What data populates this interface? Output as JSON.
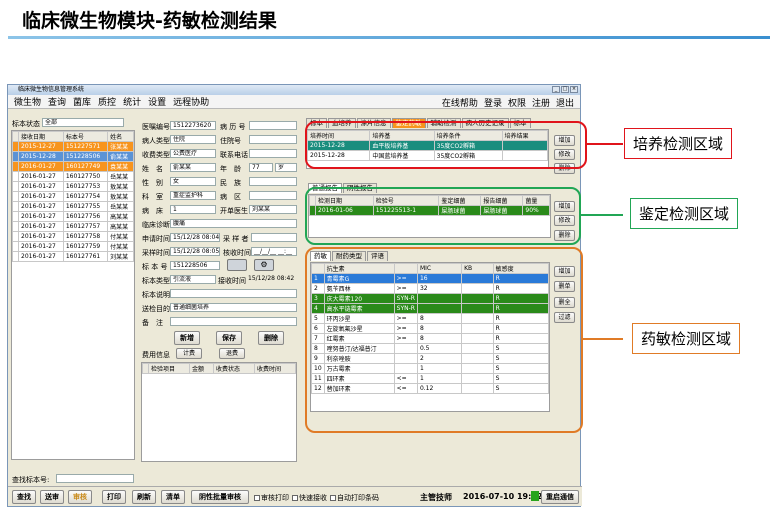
{
  "slide": {
    "title": "临床微生物模块-药敏检测结果"
  },
  "app": {
    "window_title": "临床微生物信息管理系统",
    "menu": [
      "微生物",
      "查询",
      "菌库",
      "质控",
      "统计",
      "设置",
      "远程协助"
    ],
    "menu_right": [
      "在线帮助",
      "登录",
      "权限",
      "注册",
      "退出"
    ]
  },
  "left": {
    "status_label": "标本状态",
    "status_value": "全部",
    "columns": [
      "接收日期",
      "标本号",
      "姓名"
    ],
    "rows": [
      {
        "date": "2015-12-27",
        "id": "151227571",
        "name": "张某某",
        "style": "orange"
      },
      {
        "date": "2015-12-28",
        "id": "151228506",
        "name": "俞某某",
        "style": "blue"
      },
      {
        "date": "2016-01-27",
        "id": "160127749",
        "name": "袁某某",
        "style": "orange"
      },
      {
        "date": "2016-01-27",
        "id": "160127750",
        "name": "岳某某",
        "style": ""
      },
      {
        "date": "2016-01-27",
        "id": "160127753",
        "name": "敖某某",
        "style": ""
      },
      {
        "date": "2016-01-27",
        "id": "160127754",
        "name": "敖某某",
        "style": ""
      },
      {
        "date": "2016-01-27",
        "id": "160127755",
        "name": "岳某某",
        "style": ""
      },
      {
        "date": "2016-01-27",
        "id": "160127756",
        "name": "高某某",
        "style": ""
      },
      {
        "date": "2016-01-27",
        "id": "160127757",
        "name": "高某某",
        "style": ""
      },
      {
        "date": "2016-01-27",
        "id": "160127758",
        "name": "付某某",
        "style": ""
      },
      {
        "date": "2016-01-27",
        "id": "160127759",
        "name": "付某某",
        "style": ""
      },
      {
        "date": "2016-01-27",
        "id": "160127761",
        "name": "刘某某",
        "style": ""
      }
    ],
    "search_label": "查找标本号:"
  },
  "form": {
    "medical_no_label": "医嘱编号",
    "medical_no": "1512273620",
    "record_no_label": "病 历 号",
    "patient_type_label": "病人类型",
    "patient_type": "住院",
    "bed_label": "住院号",
    "fee_type_label": "收费类型",
    "fee_type": "公费医疗",
    "phone_label": "联系电话",
    "name_label": "姓　名",
    "name": "俞某某",
    "age_label": "年　龄",
    "age": "77",
    "age_unit": "岁",
    "sex_label": "性　别",
    "sex": "女",
    "nation_label": "民　族",
    "dept_label": "科　室",
    "dept": "重症监护科",
    "ward_label": "病　区",
    "room_label": "病　床",
    "room": "1",
    "doctor_label": "开单医生",
    "doctor": "刘某某",
    "diag_label": "临床诊断",
    "diag": "腹痛",
    "apply_time_label": "申请时间",
    "apply_time": "15/12/28 08:04",
    "collector_label": "采 样 者",
    "sample_time_label": "采样时间",
    "sample_time": "15/12/28 08:05",
    "receive_time_label": "核收时间",
    "receive_time": "__/__/__ __:__",
    "sample_no_label": "标 本 号",
    "sample_no": "151228506",
    "sample_type_label": "标本类型",
    "sample_type": "引流液",
    "receive_time2_label": "接收时间",
    "receive_time2": "15/12/28 08:42",
    "sample_desc_label": "标本说明",
    "purpose_label": "送检目的",
    "purpose": "普通细菌培养",
    "note_label": "备　注",
    "btn_new": "新增",
    "btn_save": "保存",
    "btn_delete": "删除",
    "fee_label": "费用信息",
    "btn_charge": "计费",
    "btn_refund": "退费",
    "fee_columns": [
      "检验项目",
      "金额",
      "收费状态",
      "收费时间"
    ]
  },
  "culture": {
    "tabs": [
      "标本",
      "血培养",
      "涂片信息",
      "鉴定药敏",
      "辅助检测",
      "病人历史记录",
      "标本"
    ],
    "columns": [
      "培养时间",
      "培养基",
      "培养条件",
      "培养结果"
    ],
    "rows": [
      {
        "time": "2015-12-28",
        "medium": "血平板培养基",
        "cond": "35度CO2孵箱",
        "style": "teal"
      },
      {
        "time": "2015-12-28",
        "medium": "中国蓝培养基",
        "cond": "35度CO2孵箱",
        "style": ""
      }
    ],
    "btn_add": "增加",
    "btn_edit": "修改",
    "btn_delete": "删除"
  },
  "ident": {
    "tabs": [
      "普通报告",
      "阴性报告"
    ],
    "columns": [
      "检测日期",
      "检验号",
      "鉴定细菌",
      "报告细菌",
      "菌量"
    ],
    "rows": [
      {
        "date": "2016-01-06",
        "no": "151225513-1",
        "bact": "屎肠球菌",
        "report": "屎肠球菌",
        "qty": "90%"
      }
    ],
    "btn_add": "增加",
    "btn_edit": "修改",
    "btn_delete": "删除"
  },
  "sens": {
    "tabs": [
      "药敏",
      "耐药类型",
      "评语"
    ],
    "columns": [
      "",
      "抗生素",
      "",
      "MIC",
      "KB",
      "敏感度"
    ],
    "rows": [
      {
        "n": "1",
        "drug": "青霉素G",
        "op": ">=",
        "mic": "16",
        "kb": "",
        "res": "R",
        "style": "sel"
      },
      {
        "n": "2",
        "drug": "氨苄西林",
        "op": ">=",
        "mic": "32",
        "kb": "",
        "res": "R",
        "style": ""
      },
      {
        "n": "3",
        "drug": "庆大霉素120",
        "op": "SYN-R",
        "mic": "",
        "kb": "",
        "res": "R",
        "style": "green"
      },
      {
        "n": "4",
        "drug": "高水平链霉素",
        "op": "SYN-R",
        "mic": "",
        "kb": "",
        "res": "R",
        "style": "green"
      },
      {
        "n": "5",
        "drug": "环丙沙星",
        "op": ">=",
        "mic": "8",
        "kb": "",
        "res": "R",
        "style": ""
      },
      {
        "n": "6",
        "drug": "左旋氧氟沙星",
        "op": ">=",
        "mic": "8",
        "kb": "",
        "res": "R",
        "style": ""
      },
      {
        "n": "7",
        "drug": "红霉素",
        "op": ">=",
        "mic": "8",
        "kb": "",
        "res": "R",
        "style": ""
      },
      {
        "n": "8",
        "drug": "喹努普汀/达福普汀",
        "op": "",
        "mic": "0.5",
        "kb": "",
        "res": "S",
        "style": ""
      },
      {
        "n": "9",
        "drug": "利奈唑胺",
        "op": "",
        "mic": "2",
        "kb": "",
        "res": "S",
        "style": ""
      },
      {
        "n": "10",
        "drug": "万古霉素",
        "op": "",
        "mic": "1",
        "kb": "",
        "res": "S",
        "style": ""
      },
      {
        "n": "11",
        "drug": "四环素",
        "op": "<=",
        "mic": "1",
        "kb": "",
        "res": "S",
        "style": ""
      },
      {
        "n": "12",
        "drug": "替加环素",
        "op": "<=",
        "mic": "0.12",
        "kb": "",
        "res": "S",
        "style": ""
      }
    ],
    "btn_add": "增加",
    "btn_delete": "删单",
    "btn_delete_all": "删全",
    "btn_filter": "过滤"
  },
  "bottom": {
    "buttons": [
      "查找",
      "送审",
      "审核",
      "打印",
      "刷新",
      "清单",
      "阴性批量审核"
    ],
    "checks": [
      "审核打印",
      "快速接收",
      "自动打印条码"
    ],
    "user": "主管技师",
    "datetime": "2016-07-10 19:32",
    "btn_comm": "重启通信"
  },
  "annotations": {
    "culture": "培养检测区域",
    "ident": "鉴定检测区域",
    "sens": "药敏检测区域",
    "colors": {
      "culture": "#e0141b",
      "ident": "#21a655",
      "sens": "#e07b26"
    }
  }
}
